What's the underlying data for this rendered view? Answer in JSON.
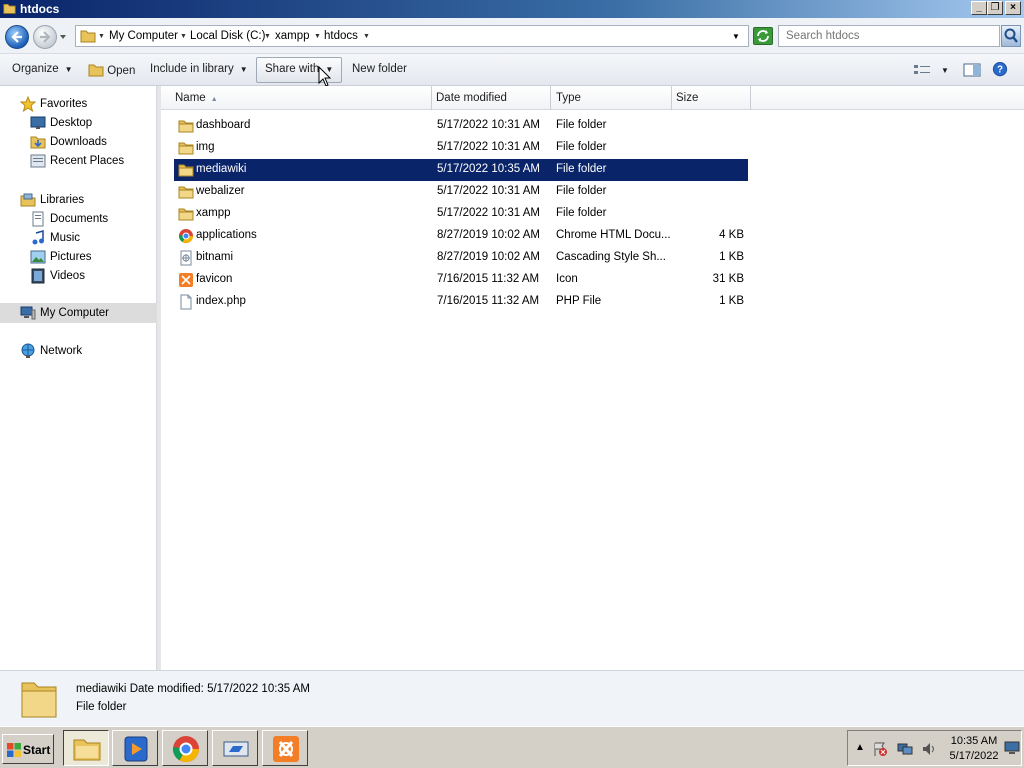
{
  "window": {
    "title": "htdocs"
  },
  "address": {
    "crumbs": [
      "My Computer",
      "Local Disk (C:)",
      "xampp",
      "htdocs"
    ]
  },
  "search": {
    "placeholder": "Search htdocs"
  },
  "toolbar": {
    "organize": "Organize",
    "open": "Open",
    "include": "Include in library",
    "share": "Share with",
    "newfolder": "New folder"
  },
  "nav": {
    "favorites": "Favorites",
    "desktop": "Desktop",
    "downloads": "Downloads",
    "recent": "Recent Places",
    "libraries": "Libraries",
    "documents": "Documents",
    "music": "Music",
    "pictures": "Pictures",
    "videos": "Videos",
    "computer": "My Computer",
    "network": "Network"
  },
  "columns": {
    "name": "Name",
    "date": "Date modified",
    "type": "Type",
    "size": "Size"
  },
  "files": [
    {
      "name": "dashboard",
      "date": "5/17/2022 10:31 AM",
      "type": "File folder",
      "size": "",
      "icon": "folder-icon"
    },
    {
      "name": "img",
      "date": "5/17/2022 10:31 AM",
      "type": "File folder",
      "size": "",
      "icon": "folder-icon"
    },
    {
      "name": "mediawiki",
      "date": "5/17/2022 10:35 AM",
      "type": "File folder",
      "size": "",
      "icon": "folder-icon",
      "selected": true
    },
    {
      "name": "webalizer",
      "date": "5/17/2022 10:31 AM",
      "type": "File folder",
      "size": "",
      "icon": "folder-icon"
    },
    {
      "name": "xampp",
      "date": "5/17/2022 10:31 AM",
      "type": "File folder",
      "size": "",
      "icon": "folder-icon"
    },
    {
      "name": "applications",
      "date": "8/27/2019 10:02 AM",
      "type": "Chrome HTML Docu...",
      "size": "4 KB",
      "icon": "chrome-icon"
    },
    {
      "name": "bitnami",
      "date": "8/27/2019 10:02 AM",
      "type": "Cascading Style Sh...",
      "size": "1 KB",
      "icon": "css-file-icon"
    },
    {
      "name": "favicon",
      "date": "7/16/2015 11:32 AM",
      "type": "Icon",
      "size": "31 KB",
      "icon": "xampp-icon"
    },
    {
      "name": "index.php",
      "date": "7/16/2015 11:32 AM",
      "type": "PHP File",
      "size": "1 KB",
      "icon": "file-icon"
    }
  ],
  "details": {
    "name": "mediawiki",
    "date_label": "Date modified:",
    "date": "5/17/2022 10:35 AM",
    "type": "File folder"
  },
  "taskbar": {
    "start": "Start",
    "time": "10:35 AM",
    "date": "5/17/2022"
  }
}
